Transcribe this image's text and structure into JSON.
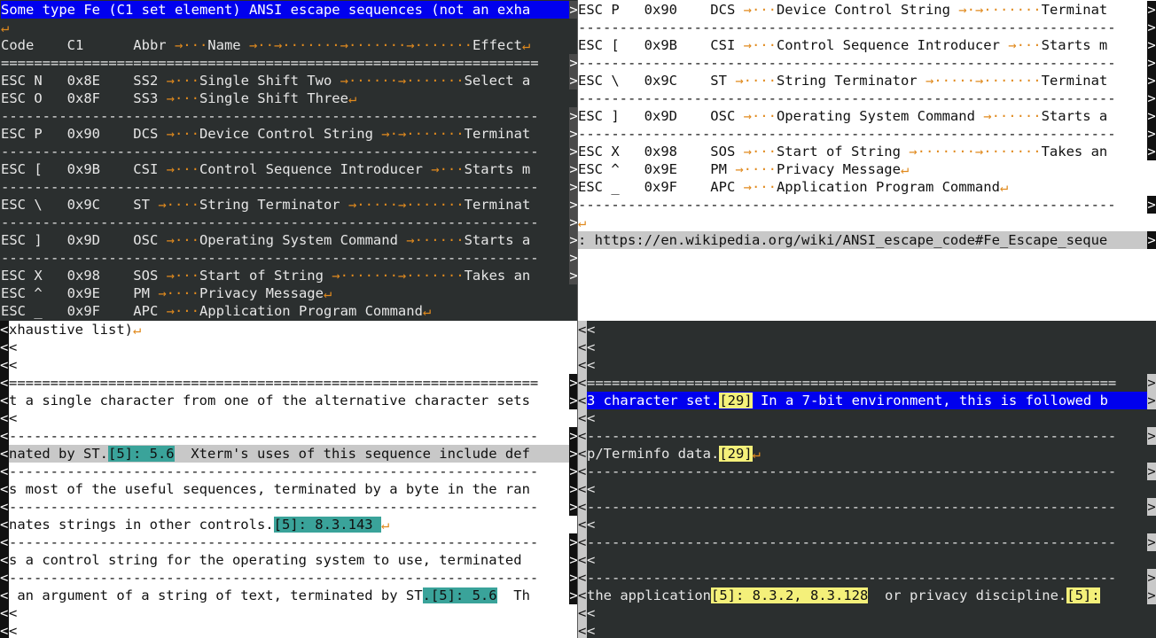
{
  "top_left": {
    "lines": [
      {
        "text": "Some type Fe (C1 set element) ANSI escape sequences (not an exha",
        "style": "blue"
      },
      {
        "text": "",
        "eol": true
      },
      {
        "text": "Code    C1      Abbr →···Name →··→·······→·······→·······Effect",
        "eol": true
      },
      {
        "text": "================================================================="
      },
      {
        "text": "ESC N   0x8E    SS2 →···Single Shift Two →······→·······Select a"
      },
      {
        "text": "ESC O   0x8F    SS3 →···Single Shift Three",
        "eol": true
      },
      {
        "text": "-----------------------------------------------------------------"
      },
      {
        "text": "ESC P   0x90    DCS →···Device Control String →·→·······Terminat"
      },
      {
        "text": "-----------------------------------------------------------------"
      },
      {
        "text": "ESC [   0x9B    CSI →···Control Sequence Introducer →···Starts m"
      },
      {
        "text": "-----------------------------------------------------------------"
      },
      {
        "text": "ESC \\   0x9C    ST →····String Terminator →·····→·······Terminat"
      },
      {
        "text": "-----------------------------------------------------------------"
      },
      {
        "text": "ESC ]   0x9D    OSC →···Operating System Command →······Starts a"
      },
      {
        "text": "-----------------------------------------------------------------"
      },
      {
        "text": "ESC X   0x98    SOS →···Start of String →·······→·······Takes an"
      },
      {
        "text": "ESC ^   0x9E    PM →····Privacy Message",
        "eol": true
      },
      {
        "text": "ESC _   0x9F    APC →···Application Program Command",
        "eol": true
      }
    ]
  },
  "top_right": {
    "lines": [
      {
        "text": "ESC P   0x90    DCS →···Device Control String →·→·······Terminat"
      },
      {
        "text": "-----------------------------------------------------------------"
      },
      {
        "text": "ESC [   0x9B    CSI →···Control Sequence Introducer →···Starts m"
      },
      {
        "text": "-----------------------------------------------------------------"
      },
      {
        "text": "ESC \\   0x9C    ST →····String Terminator →·····→·······Terminat"
      },
      {
        "text": "-----------------------------------------------------------------"
      },
      {
        "text": "ESC ]   0x9D    OSC →···Operating System Command →······Starts a"
      },
      {
        "text": "-----------------------------------------------------------------"
      },
      {
        "text": "ESC X   0x98    SOS →···Start of String →·······→·······Takes an"
      },
      {
        "text": "ESC ^   0x9E    PM →····Privacy Message",
        "eol": true
      },
      {
        "text": "ESC _   0x9F    APC →···Application Program Command",
        "eol": true
      },
      {
        "text": "-----------------------------------------------------------------"
      },
      {
        "text": "",
        "eol": true
      },
      {
        "text": ": https://en.wikipedia.org/wiki/ANSI_escape_code#Fe_Escape_seque",
        "style": "grey"
      }
    ]
  },
  "bottom_left": {
    "lines": [
      {
        "text": "xhaustive list)",
        "eol": true
      },
      {
        "text": ""
      },
      {
        "text": ""
      },
      {
        "text": "================================================================"
      },
      {
        "text": "t a single character from one of the alternative character sets"
      },
      {
        "text": ""
      },
      {
        "text": "----------------------------------------------------------------"
      },
      {
        "text": "nated by ST.",
        "extra": "[5]: 5.6",
        "rest": "  Xterm's uses of this sequence include def",
        "style": "grey"
      },
      {
        "text": "----------------------------------------------------------------"
      },
      {
        "text": "s most of the useful sequences, terminated by a byte in the ran"
      },
      {
        "text": "----------------------------------------------------------------"
      },
      {
        "text": "nates strings in other controls.",
        "extra": "[5]: 8.3.143 ",
        "eol": true
      },
      {
        "text": "----------------------------------------------------------------"
      },
      {
        "text": "s a control string for the operating system to use, terminated "
      },
      {
        "text": "----------------------------------------------------------------"
      },
      {
        "text": " an argument of a string of text, terminated by ST",
        "extra": ".[5]: 5.6",
        "rest": "  Th"
      },
      {
        "text": ""
      },
      {
        "text": ""
      }
    ]
  },
  "bottom_right": {
    "lines": [
      {
        "text": ""
      },
      {
        "text": ""
      },
      {
        "text": ""
      },
      {
        "text": "================================================================"
      },
      {
        "text": "3 character set.",
        "extra": "[29]",
        "rest": " In a 7-bit environment, this is followed b",
        "style": "blue"
      },
      {
        "text": ""
      },
      {
        "text": "----------------------------------------------------------------"
      },
      {
        "text": "p/Terminfo data.",
        "extra": "[29]",
        "eol": true
      },
      {
        "text": "----------------------------------------------------------------"
      },
      {
        "text": ""
      },
      {
        "text": "----------------------------------------------------------------"
      },
      {
        "text": ""
      },
      {
        "text": "----------------------------------------------------------------"
      },
      {
        "text": ""
      },
      {
        "text": "----------------------------------------------------------------"
      },
      {
        "text": "the application",
        "extra": "[5]: 8.3.2, 8.3.128",
        "rest": "  or privacy discipline.",
        "extra2": "[5]:"
      },
      {
        "text": ""
      },
      {
        "text": ""
      }
    ]
  },
  "symbols": {
    "eol": "↵",
    "left": "<",
    "right": ">"
  }
}
